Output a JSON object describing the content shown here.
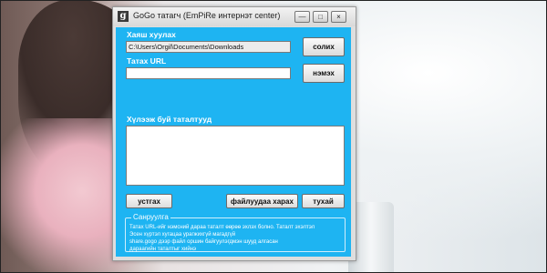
{
  "window": {
    "title": "GoGo татагч (EmPiRe интернэт center)",
    "icon": "app-g-icon",
    "controls": {
      "minimize": "—",
      "maximize": "□",
      "close": "×"
    }
  },
  "form": {
    "save_path_label": "Хаяш хуулах",
    "save_path_value": "C:\\Users\\Orgil\\Documents\\Downloads",
    "change_button": "солих",
    "url_label": "Татах URL",
    "url_value": "",
    "add_button": "нэмэх",
    "downloads_label": "Хүлээж буй татaлтууд",
    "downloads_items": []
  },
  "actions": {
    "delete_button": "устгах",
    "open_folder_button": "файлуудаа харах",
    "about_button": "тухай"
  },
  "notice": {
    "title": "Санруулга",
    "lines": [
      "Татах URL-ийг нэмсний дараа таталт өөрөө эхлэх болно. Таталт эхэлтэл",
      "Эсен хүртэл хугацаа урагжихгүй магадгүй",
      "share.gogo дээр файл оршин байгуулэгдмэн шууд алгасан",
      "дараагийн таталтыг хийнэ"
    ]
  },
  "colors": {
    "client_background": "#1eb4f2",
    "window_chrome": "#dedede"
  }
}
